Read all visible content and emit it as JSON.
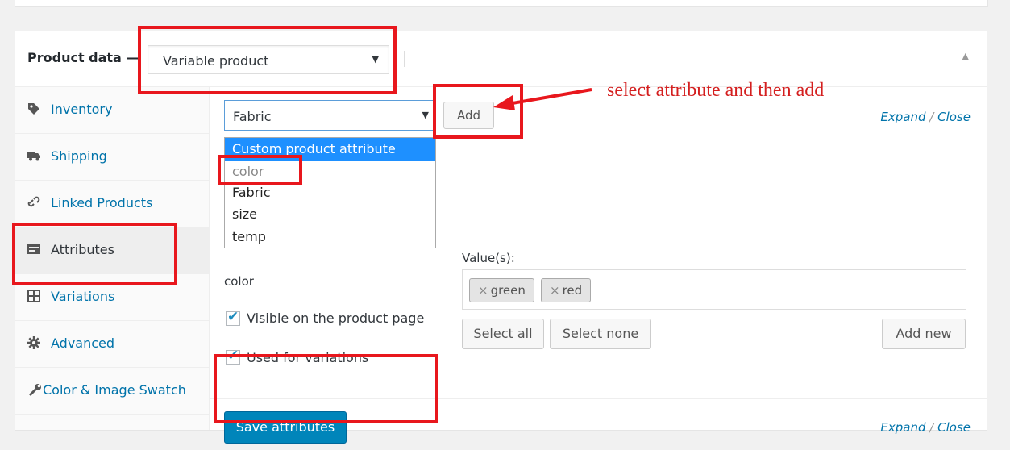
{
  "header": {
    "title": "Product data —",
    "product_type": "Variable product",
    "toggle_icon": "triangle-up-icon"
  },
  "tabs": [
    {
      "label": "Inventory",
      "icon": "tag-icon"
    },
    {
      "label": "Shipping",
      "icon": "truck-icon"
    },
    {
      "label": "Linked Products",
      "icon": "link-icon"
    },
    {
      "label": "Attributes",
      "icon": "list-icon",
      "active": true
    },
    {
      "label": "Variations",
      "icon": "grid-icon"
    },
    {
      "label": "Advanced",
      "icon": "gear-icon"
    },
    {
      "label": "Color & Image Swatch",
      "icon": "wrench-icon"
    }
  ],
  "attribute_select": {
    "value": "Fabric",
    "options": [
      "Custom product attribute",
      "color",
      "Fabric",
      "size",
      "temp"
    ]
  },
  "add_label": "Add",
  "expand_link": {
    "expand": "Expand",
    "sep": " / ",
    "close": "Close"
  },
  "attribute_row": {
    "name": "color",
    "visible_label": "Visible on the product page",
    "variations_label": "Used for variations",
    "values_label": "Value(s):",
    "values": [
      "green",
      "red"
    ],
    "select_all": "Select all",
    "select_none": "Select none",
    "add_new": "Add new"
  },
  "save_label": "Save attributes",
  "annotation": "select attribute and then add",
  "colors": {
    "accent": "#0085ba",
    "link": "#0073aa",
    "highlight": "#1e90ff",
    "annotation": "#e8171d"
  }
}
